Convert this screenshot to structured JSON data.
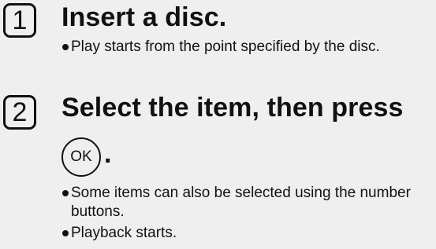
{
  "steps": [
    {
      "number": "1",
      "title": "Insert a disc.",
      "bullets": [
        "Play starts from the point specified by the disc."
      ]
    },
    {
      "number": "2",
      "title": "Select the item, then press",
      "button": "OK",
      "title_end": ".",
      "bullets": [
        "Some items can also be selected using the number buttons.",
        "Playback starts."
      ]
    }
  ]
}
